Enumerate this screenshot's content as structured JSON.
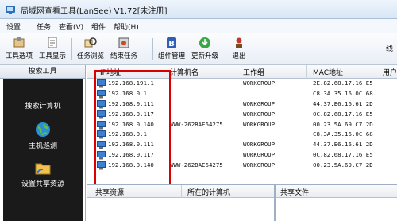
{
  "window": {
    "title": "局域网查看工具(LanSee) V1.72[未注册]"
  },
  "menu": [
    {
      "label": "设置"
    },
    {
      "label": "任务"
    },
    {
      "label": "查看(V)"
    },
    {
      "label": "组件"
    },
    {
      "label": "帮助(H)"
    }
  ],
  "toolbar": {
    "buttons": [
      {
        "label": "工具选项",
        "icon": "tool-options-icon"
      },
      {
        "label": "工具显示",
        "icon": "tool-display-icon"
      },
      {
        "label": "任务浏览",
        "icon": "task-browse-icon"
      },
      {
        "label": "结束任务",
        "icon": "end-task-icon"
      },
      {
        "label": "组件管理",
        "icon": "component-manage-icon"
      },
      {
        "label": "更新升级",
        "icon": "update-icon"
      },
      {
        "label": "退出",
        "icon": "exit-icon"
      }
    ],
    "right_text": "线"
  },
  "sidebar": {
    "header": "搜索工具",
    "items": [
      {
        "label": "搜索计算机"
      },
      {
        "label": "主机巡测",
        "icon": "globe-icon"
      },
      {
        "label": "设置共享资源",
        "icon": "folder-share-icon"
      }
    ]
  },
  "table": {
    "columns": [
      "IP地址",
      "计算机名",
      "工作组",
      "MAC地址",
      "用户"
    ],
    "rows": [
      {
        "ip": "192.168.191.1",
        "name": "",
        "group": "WORKGROUP",
        "mac": "2E.82.68.17.16.E5"
      },
      {
        "ip": "192.168.0.1",
        "name": "",
        "group": "",
        "mac": "C8.3A.35.16.0C.68"
      },
      {
        "ip": "192.168.0.111",
        "name": "",
        "group": "WORKGROUP",
        "mac": "44.37.E6.16.61.2D"
      },
      {
        "ip": "192.168.0.117",
        "name": "",
        "group": "WORKGROUP",
        "mac": "0C.82.68.17.16.E5"
      },
      {
        "ip": "192.168.0.140",
        "name": "WWW-262BAE64275",
        "group": "WORKGROUP",
        "mac": "00.23.5A.69.C7.2D"
      },
      {
        "ip": "192.168.0.1",
        "name": "",
        "group": "",
        "mac": "C8.3A.35.16.0C.68"
      },
      {
        "ip": "192.168.0.111",
        "name": "",
        "group": "WORKGROUP",
        "mac": "44.37.E6.16.61.2D"
      },
      {
        "ip": "192.168.0.117",
        "name": "",
        "group": "WORKGROUP",
        "mac": "0C.82.68.17.16.E5"
      },
      {
        "ip": "192.168.0.140",
        "name": "WWW-262BAE64275",
        "group": "WORKGROUP",
        "mac": "00.23.5A.69.C7.2D"
      }
    ]
  },
  "shares": {
    "columns": [
      "共享资源",
      "所在的计算机"
    ],
    "right_column": "共享文件"
  },
  "colors": {
    "highlight": "#d80000",
    "sidebar_bg": "#1a1a1a"
  }
}
